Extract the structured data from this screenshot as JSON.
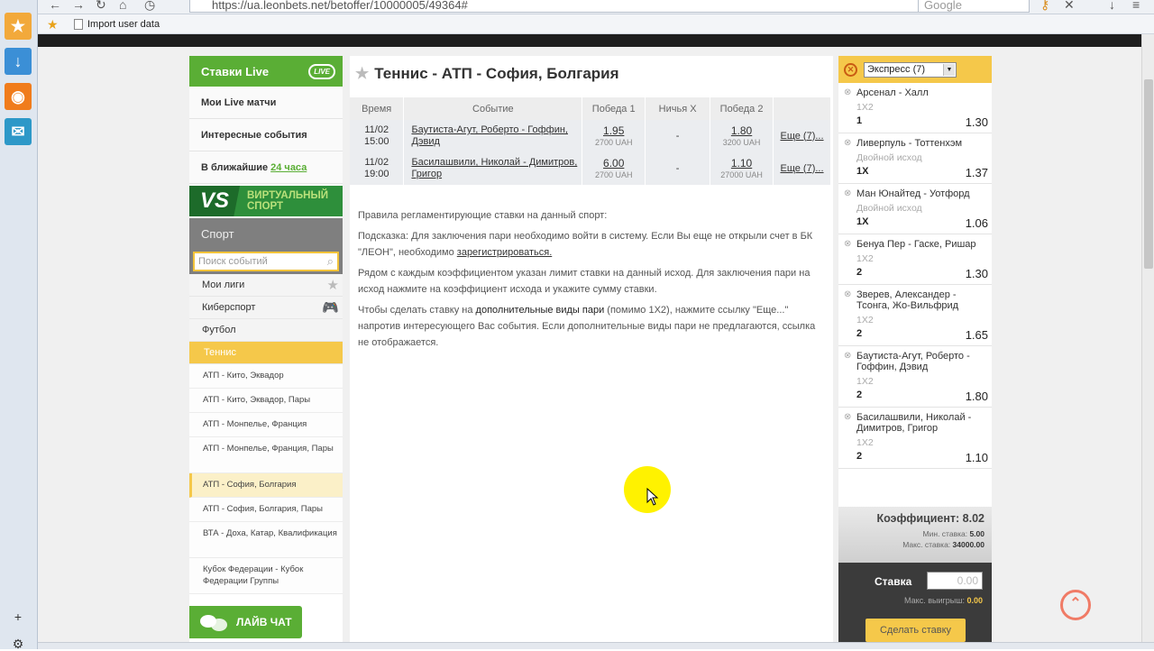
{
  "browser": {
    "url": "https://ua.leonbets.net/betoffer/10000005/49364#",
    "search_placeholder": "Google",
    "bookmark": "Import user data"
  },
  "sidebar": {
    "live_title": "Ставки Live",
    "live_badge": "LIVE",
    "links": {
      "my_live": "Мои Live матчи",
      "interesting": "Интересные события",
      "soon_prefix": "В ближайшие",
      "soon_link": "24 часа"
    },
    "virtual": {
      "logo": "VS",
      "line1": "ВИРТУАЛЬНЫЙ",
      "line2": "СПОРТ"
    },
    "sport_title": "Спорт",
    "search_placeholder": "Поиск событий",
    "sports": [
      "Мои лиги",
      "Киберспорт",
      "Футбол",
      "Теннис"
    ],
    "leagues": [
      "АТП - Кито, Эквадор",
      "АТП - Кито, Эквадор, Пары",
      "АТП - Монпелье, Франция",
      "АТП - Монпелье, Франция, Пары",
      "АТП - София, Болгария",
      "АТП - София, Болгария, Пары",
      "ВТА - Доха, Катар, Квалификация",
      "Кубок Федерации - Кубок Федерации Группы"
    ],
    "chat": "ЛАЙВ ЧАТ"
  },
  "main": {
    "title": "Теннис - АТП - София, Болгария",
    "columns": [
      "Время",
      "Событие",
      "Победа 1",
      "Ничья X",
      "Победа 2"
    ],
    "events": [
      {
        "date": "11/02",
        "time": "15:00",
        "name": "Баутиста-Агут, Роберто - Гоффин, Дэвид",
        "win1": "1.95",
        "lim1": "2700 UAH",
        "draw": "-",
        "win2": "1.80",
        "lim2": "3200 UAH",
        "more": "Еще (7)..."
      },
      {
        "date": "11/02",
        "time": "19:00",
        "name": "Басилашвили, Николай - Димитров, Григор",
        "win1": "6.00",
        "lim1": "2700 UAH",
        "draw": "-",
        "win2": "1.10",
        "lim2": "27000 UAH",
        "more": "Еще (7)..."
      }
    ],
    "rules": {
      "heading": "Правила регламентирующие ставки на данный спорт:",
      "hint_a": "Подсказка: Для заключения пари необходимо войти в систему. Если Вы еще не открыли счет в БК \"ЛЕОН\", необходимо",
      "hint_link": "зарегистрироваться.",
      "p2": "Рядом с каждым коэффициентом указан лимит ставки на данный исход. Для заключения пари на исход нажмите на коэффициент исхода и укажите сумму ставки.",
      "p3_a": "Чтобы сделать ставку на",
      "p3_bold": "дополнительные виды пари",
      "p3_b": "(помимо 1X2), нажмите ссылку \"Еще...\" напротив интересующего Вас события. Если дополнительные виды пари не предлагаются, ссылка не отображается."
    }
  },
  "slip": {
    "mode": "Экспресс (7)",
    "bets": [
      {
        "event": "Арсенал - Халл",
        "market": "1X2",
        "result": "1",
        "odds": "1.30"
      },
      {
        "event": "Ливерпуль - Тоттенхэм",
        "market": "Двойной исход",
        "result": "1X",
        "odds": "1.37"
      },
      {
        "event": "Ман Юнайтед - Уотфорд",
        "market": "Двойной исход",
        "result": "1X",
        "odds": "1.06"
      },
      {
        "event": "Бенуа Пер - Гаске, Ришар",
        "market": "1X2",
        "result": "2",
        "odds": "1.30"
      },
      {
        "event": "Зверев, Александер - Тсонга, Жо-Вильфрид",
        "market": "1X2",
        "result": "2",
        "odds": "1.65"
      },
      {
        "event": "Баутиста-Агут, Роберто - Гоффин, Дэвид",
        "market": "1X2",
        "result": "2",
        "odds": "1.80"
      },
      {
        "event": "Басилашвили, Николай - Димитров, Григор",
        "market": "1X2",
        "result": "2",
        "odds": "1.10"
      }
    ],
    "coef_label": "Коэффициент:",
    "coef_value": "8.02",
    "min_label": "Мин. ставка:",
    "min_value": "5.00",
    "max_label": "Макс. ставка:",
    "max_value": "34000.00",
    "stake_label": "Ставка",
    "stake_value": "0.00",
    "max_win_label": "Макс. выигрыш:",
    "max_win_value": "0.00",
    "submit": "Сделать ставку"
  },
  "colors": {
    "live_green": "#5aae35",
    "accent_yellow": "#f5c84a",
    "virtual_green": "#2e8f3b"
  }
}
